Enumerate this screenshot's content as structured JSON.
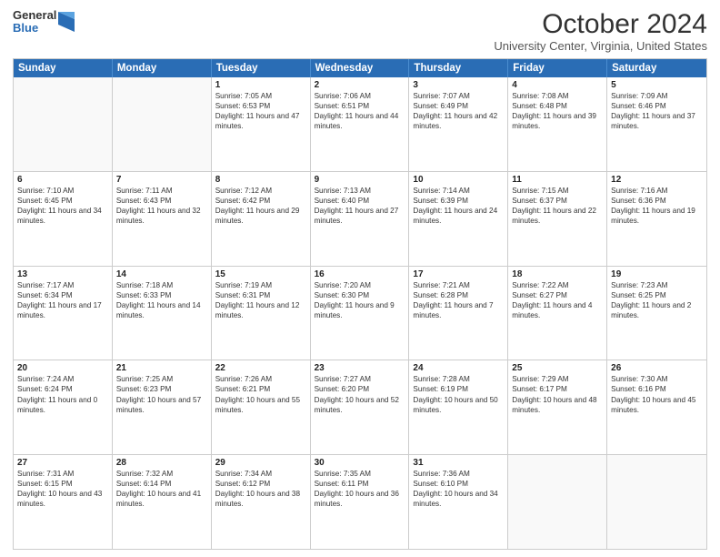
{
  "header": {
    "logo": {
      "line1": "General",
      "line2": "Blue"
    },
    "title": "October 2024",
    "subtitle": "University Center, Virginia, United States"
  },
  "calendar": {
    "days": [
      "Sunday",
      "Monday",
      "Tuesday",
      "Wednesday",
      "Thursday",
      "Friday",
      "Saturday"
    ],
    "rows": [
      [
        {
          "day": "",
          "empty": true
        },
        {
          "day": "",
          "empty": true
        },
        {
          "day": "1",
          "sunrise": "Sunrise: 7:05 AM",
          "sunset": "Sunset: 6:53 PM",
          "daylight": "Daylight: 11 hours and 47 minutes."
        },
        {
          "day": "2",
          "sunrise": "Sunrise: 7:06 AM",
          "sunset": "Sunset: 6:51 PM",
          "daylight": "Daylight: 11 hours and 44 minutes."
        },
        {
          "day": "3",
          "sunrise": "Sunrise: 7:07 AM",
          "sunset": "Sunset: 6:49 PM",
          "daylight": "Daylight: 11 hours and 42 minutes."
        },
        {
          "day": "4",
          "sunrise": "Sunrise: 7:08 AM",
          "sunset": "Sunset: 6:48 PM",
          "daylight": "Daylight: 11 hours and 39 minutes."
        },
        {
          "day": "5",
          "sunrise": "Sunrise: 7:09 AM",
          "sunset": "Sunset: 6:46 PM",
          "daylight": "Daylight: 11 hours and 37 minutes."
        }
      ],
      [
        {
          "day": "6",
          "sunrise": "Sunrise: 7:10 AM",
          "sunset": "Sunset: 6:45 PM",
          "daylight": "Daylight: 11 hours and 34 minutes."
        },
        {
          "day": "7",
          "sunrise": "Sunrise: 7:11 AM",
          "sunset": "Sunset: 6:43 PM",
          "daylight": "Daylight: 11 hours and 32 minutes."
        },
        {
          "day": "8",
          "sunrise": "Sunrise: 7:12 AM",
          "sunset": "Sunset: 6:42 PM",
          "daylight": "Daylight: 11 hours and 29 minutes."
        },
        {
          "day": "9",
          "sunrise": "Sunrise: 7:13 AM",
          "sunset": "Sunset: 6:40 PM",
          "daylight": "Daylight: 11 hours and 27 minutes."
        },
        {
          "day": "10",
          "sunrise": "Sunrise: 7:14 AM",
          "sunset": "Sunset: 6:39 PM",
          "daylight": "Daylight: 11 hours and 24 minutes."
        },
        {
          "day": "11",
          "sunrise": "Sunrise: 7:15 AM",
          "sunset": "Sunset: 6:37 PM",
          "daylight": "Daylight: 11 hours and 22 minutes."
        },
        {
          "day": "12",
          "sunrise": "Sunrise: 7:16 AM",
          "sunset": "Sunset: 6:36 PM",
          "daylight": "Daylight: 11 hours and 19 minutes."
        }
      ],
      [
        {
          "day": "13",
          "sunrise": "Sunrise: 7:17 AM",
          "sunset": "Sunset: 6:34 PM",
          "daylight": "Daylight: 11 hours and 17 minutes."
        },
        {
          "day": "14",
          "sunrise": "Sunrise: 7:18 AM",
          "sunset": "Sunset: 6:33 PM",
          "daylight": "Daylight: 11 hours and 14 minutes."
        },
        {
          "day": "15",
          "sunrise": "Sunrise: 7:19 AM",
          "sunset": "Sunset: 6:31 PM",
          "daylight": "Daylight: 11 hours and 12 minutes."
        },
        {
          "day": "16",
          "sunrise": "Sunrise: 7:20 AM",
          "sunset": "Sunset: 6:30 PM",
          "daylight": "Daylight: 11 hours and 9 minutes."
        },
        {
          "day": "17",
          "sunrise": "Sunrise: 7:21 AM",
          "sunset": "Sunset: 6:28 PM",
          "daylight": "Daylight: 11 hours and 7 minutes."
        },
        {
          "day": "18",
          "sunrise": "Sunrise: 7:22 AM",
          "sunset": "Sunset: 6:27 PM",
          "daylight": "Daylight: 11 hours and 4 minutes."
        },
        {
          "day": "19",
          "sunrise": "Sunrise: 7:23 AM",
          "sunset": "Sunset: 6:25 PM",
          "daylight": "Daylight: 11 hours and 2 minutes."
        }
      ],
      [
        {
          "day": "20",
          "sunrise": "Sunrise: 7:24 AM",
          "sunset": "Sunset: 6:24 PM",
          "daylight": "Daylight: 11 hours and 0 minutes."
        },
        {
          "day": "21",
          "sunrise": "Sunrise: 7:25 AM",
          "sunset": "Sunset: 6:23 PM",
          "daylight": "Daylight: 10 hours and 57 minutes."
        },
        {
          "day": "22",
          "sunrise": "Sunrise: 7:26 AM",
          "sunset": "Sunset: 6:21 PM",
          "daylight": "Daylight: 10 hours and 55 minutes."
        },
        {
          "day": "23",
          "sunrise": "Sunrise: 7:27 AM",
          "sunset": "Sunset: 6:20 PM",
          "daylight": "Daylight: 10 hours and 52 minutes."
        },
        {
          "day": "24",
          "sunrise": "Sunrise: 7:28 AM",
          "sunset": "Sunset: 6:19 PM",
          "daylight": "Daylight: 10 hours and 50 minutes."
        },
        {
          "day": "25",
          "sunrise": "Sunrise: 7:29 AM",
          "sunset": "Sunset: 6:17 PM",
          "daylight": "Daylight: 10 hours and 48 minutes."
        },
        {
          "day": "26",
          "sunrise": "Sunrise: 7:30 AM",
          "sunset": "Sunset: 6:16 PM",
          "daylight": "Daylight: 10 hours and 45 minutes."
        }
      ],
      [
        {
          "day": "27",
          "sunrise": "Sunrise: 7:31 AM",
          "sunset": "Sunset: 6:15 PM",
          "daylight": "Daylight: 10 hours and 43 minutes."
        },
        {
          "day": "28",
          "sunrise": "Sunrise: 7:32 AM",
          "sunset": "Sunset: 6:14 PM",
          "daylight": "Daylight: 10 hours and 41 minutes."
        },
        {
          "day": "29",
          "sunrise": "Sunrise: 7:34 AM",
          "sunset": "Sunset: 6:12 PM",
          "daylight": "Daylight: 10 hours and 38 minutes."
        },
        {
          "day": "30",
          "sunrise": "Sunrise: 7:35 AM",
          "sunset": "Sunset: 6:11 PM",
          "daylight": "Daylight: 10 hours and 36 minutes."
        },
        {
          "day": "31",
          "sunrise": "Sunrise: 7:36 AM",
          "sunset": "Sunset: 6:10 PM",
          "daylight": "Daylight: 10 hours and 34 minutes."
        },
        {
          "day": "",
          "empty": true
        },
        {
          "day": "",
          "empty": true
        }
      ]
    ]
  }
}
